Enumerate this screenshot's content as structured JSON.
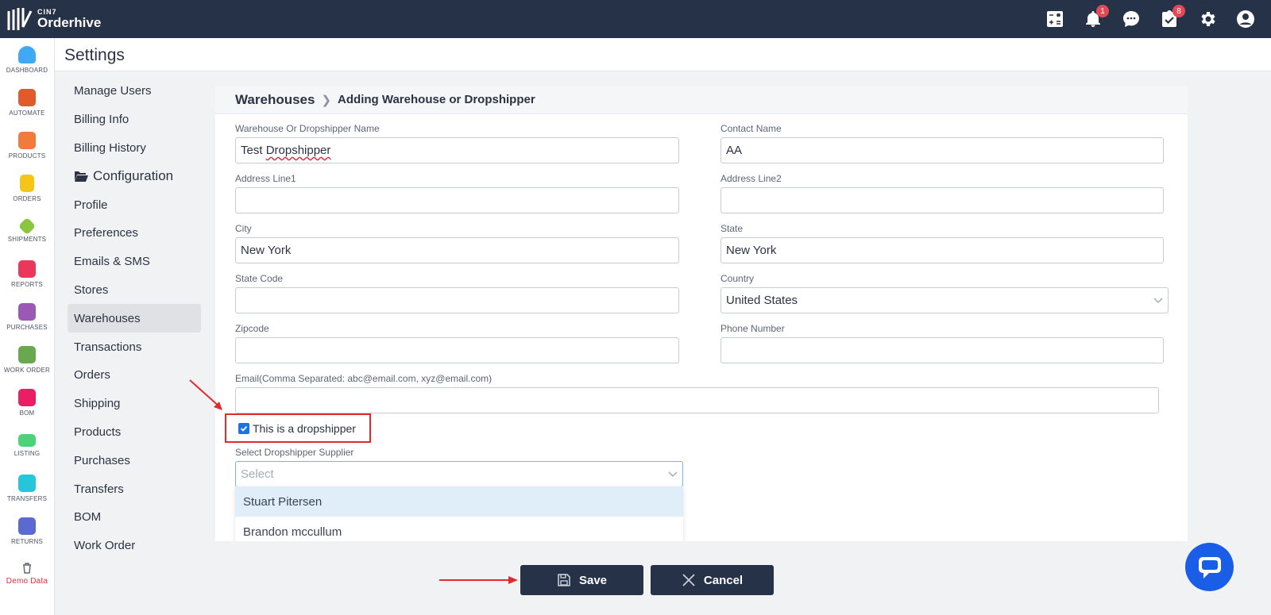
{
  "app": {
    "brand_small": "CIN7",
    "brand_name": "Orderhive"
  },
  "topbar": {
    "notifications_badge": "1",
    "tasks_badge": "8"
  },
  "leftnav": {
    "items": [
      {
        "label": "DASHBOARD",
        "color": "#3fa9f5"
      },
      {
        "label": "AUTOMATE",
        "color": "#e05a2b"
      },
      {
        "label": "PRODUCTS",
        "color": "#f07b3b"
      },
      {
        "label": "ORDERS",
        "color": "#f5c518"
      },
      {
        "label": "SHIPMENTS",
        "color": "#8cc63f"
      },
      {
        "label": "REPORTS",
        "color": "#e8395a"
      },
      {
        "label": "PURCHASES",
        "color": "#9b59b6"
      },
      {
        "label": "WORK ORDER",
        "color": "#6aa84f"
      },
      {
        "label": "BOM",
        "color": "#e91e63"
      },
      {
        "label": "LISTING",
        "color": "#4cd37a"
      },
      {
        "label": "TRANSFERS",
        "color": "#26c6da"
      },
      {
        "label": "RETURNS",
        "color": "#5b6ad0"
      }
    ],
    "demo_label": "Demo Data"
  },
  "header": {
    "title": "Settings"
  },
  "settings_menu": {
    "items": [
      "Manage Users",
      "Billing Info",
      "Billing History",
      "Configuration",
      "Profile",
      "Preferences",
      "Emails & SMS",
      "Stores",
      "Warehouses",
      "Transactions",
      "Orders",
      "Shipping",
      "Products",
      "Purchases",
      "Transfers",
      "BOM",
      "Work Order"
    ],
    "active": "Warehouses"
  },
  "breadcrumb": {
    "root": "Warehouses",
    "current": "Adding Warehouse or Dropshipper"
  },
  "form": {
    "name_label": "Warehouse Or Dropshipper Name",
    "name_value_1": "Test",
    "name_value_2": "Dropshipper",
    "contact_label": "Contact Name",
    "contact_value": "AA",
    "address1_label": "Address Line1",
    "address1_value": "",
    "address2_label": "Address Line2",
    "address2_value": "",
    "city_label": "City",
    "city_value": "New York",
    "state_label": "State",
    "state_value": "New York",
    "statecode_label": "State Code",
    "statecode_value": "",
    "country_label": "Country",
    "country_value": "United States",
    "zip_label": "Zipcode",
    "zip_value": "",
    "phone_label": "Phone Number",
    "phone_value": "",
    "email_label": "Email(Comma Separated: abc@email.com, xyz@email.com)",
    "email_value": "",
    "dropshipper_checkbox_label": "This is a dropshipper",
    "dropshipper_checked": true,
    "supplier_label": "Select Dropshipper Supplier",
    "supplier_placeholder": "Select",
    "supplier_options": [
      "Stuart Pitersen",
      "Brandon mccullum"
    ]
  },
  "footer": {
    "save_label": "Save",
    "cancel_label": "Cancel"
  },
  "colors": {
    "nav_bg": "#263248",
    "highlight": "#e02b2b",
    "accent": "#1a73e8"
  }
}
